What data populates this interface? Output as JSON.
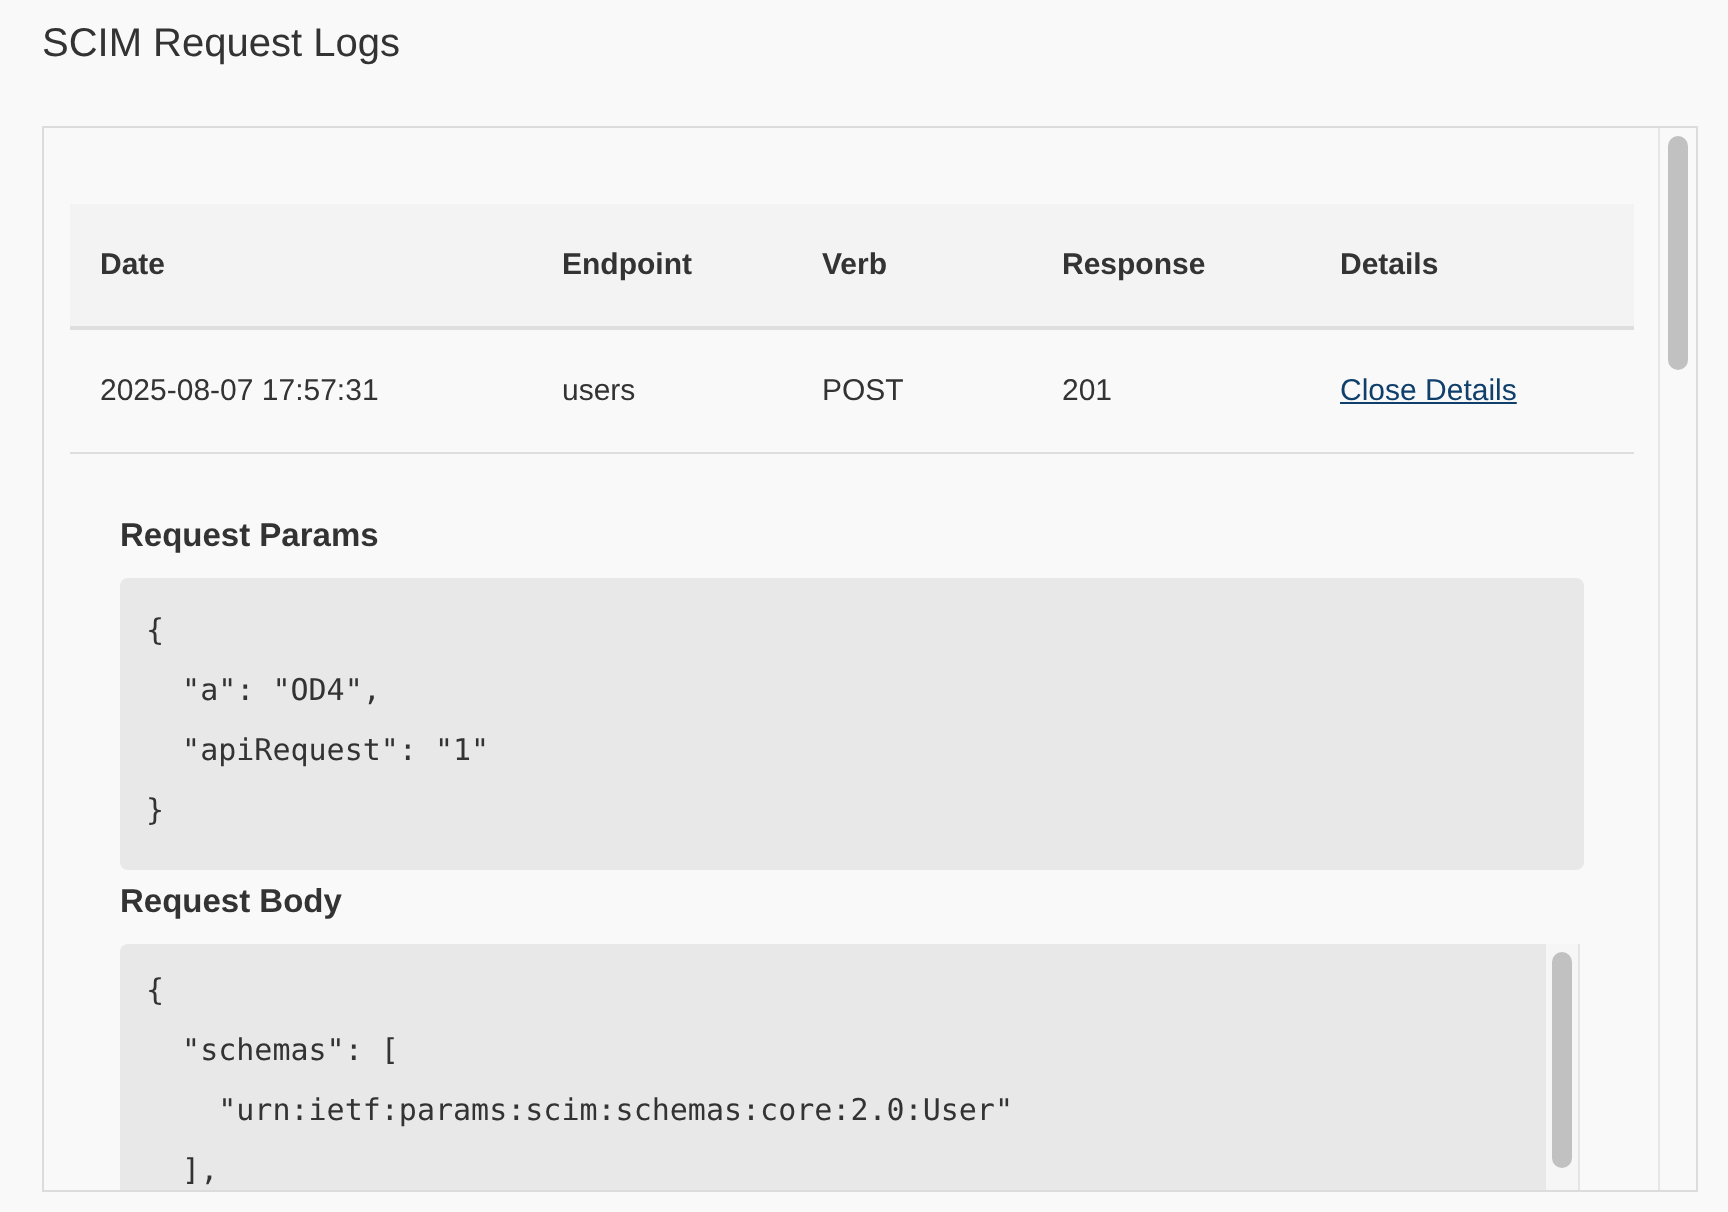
{
  "page": {
    "title": "SCIM Request Logs"
  },
  "table": {
    "columns": [
      "Date",
      "Endpoint",
      "Verb",
      "Response",
      "Details"
    ],
    "rows": [
      {
        "date": "2025-08-07 17:57:31",
        "endpoint": "users",
        "verb": "POST",
        "response": "201",
        "details_link": "Close Details",
        "expanded": true,
        "sections": [
          {
            "heading": "Request Params",
            "scrollable": false,
            "lines": [
              "{",
              "  \"a\": \"OD4\",",
              "  \"apiRequest\": \"1\"",
              "}"
            ]
          },
          {
            "heading": "Request Body",
            "scrollable": true,
            "lines": [
              "{",
              "  \"schemas\": [",
              "    \"urn:ietf:params:scim:schemas:core:2.0:User\"",
              "  ],"
            ]
          }
        ]
      }
    ]
  }
}
